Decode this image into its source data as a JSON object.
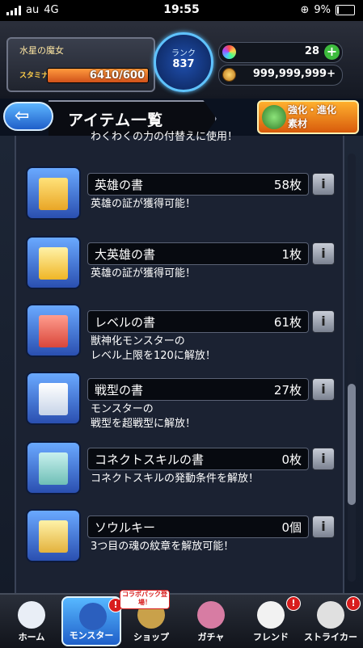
{
  "status_bar": {
    "carrier": "au",
    "network": "4G",
    "time": "19:55",
    "battery": "9%"
  },
  "player": {
    "name": "水星の魔女",
    "stamina_label": "スタミナ",
    "stamina": "6410/600",
    "stamina_fraction": 1.0
  },
  "rank": {
    "label": "ランク",
    "value": "837"
  },
  "currency": {
    "orbs": "28",
    "coins": "999,999,999+"
  },
  "title": {
    "back_icon": "back-arrow-icon",
    "text": "アイテム一覧"
  },
  "evolve_button": {
    "line1": "強化・進化",
    "line2": "素材"
  },
  "items": [
    {
      "name": "英雄の書",
      "count": "58枚",
      "desc": "英雄の証が獲得可能！",
      "glyph": "g1"
    },
    {
      "name": "大英雄の書",
      "count": "1枚",
      "desc": "英雄の証が獲得可能！",
      "glyph": "g2"
    },
    {
      "name": "レベルの書",
      "count": "61枚",
      "desc": "獣神化モンスターの\nレベル上限を120に解放！",
      "glyph": "g3"
    },
    {
      "name": "戦型の書",
      "count": "27枚",
      "desc": "モンスターの\n戦型を超戦型に解放！",
      "glyph": "g4"
    },
    {
      "name": "コネクトスキルの書",
      "count": "0枚",
      "desc": "コネクトスキルの発動条件を解放！",
      "glyph": "g5"
    },
    {
      "name": "ソウルキー",
      "count": "0個",
      "desc": "3つ目の魂の紋章を解放可能！",
      "glyph": "g6"
    }
  ],
  "partial_top": {
    "text": "わくわくの力の付替えに使用！"
  },
  "scroll_position": 0.75,
  "tabs": [
    {
      "label": "ホーム",
      "icon": "home-icon",
      "badge": ""
    },
    {
      "label": "モンスター",
      "icon": "monster-icon",
      "badge": "!"
    },
    {
      "label": "ショップ",
      "icon": "shop-icon",
      "badge": ""
    },
    {
      "label": "ガチャ",
      "icon": "gacha-icon",
      "badge": ""
    },
    {
      "label": "フレンド",
      "icon": "friend-icon",
      "badge": "!"
    },
    {
      "label": "ストライカー",
      "icon": "striker-icon",
      "badge": "!"
    }
  ],
  "collab_banner": "コラボパック登場！",
  "colors": {
    "accent": "#1f5fc9",
    "stamina": "#d0521a",
    "badge": "#d81d1d"
  }
}
